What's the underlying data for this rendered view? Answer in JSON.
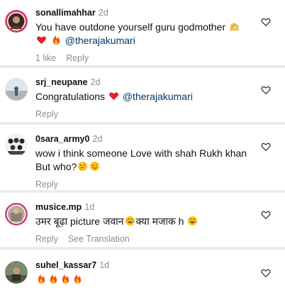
{
  "comments": [
    {
      "username": "sonallimahhar",
      "time": "2d",
      "text_line1": "You have outdone yourself guru godmother",
      "mention": "@therajakumari",
      "emojis": [
        "raising-hands",
        "red-heart",
        "fire"
      ],
      "likes": "1 like",
      "reply": "Reply"
    },
    {
      "username": "srj_neupane",
      "time": "2d",
      "text": "Congratulations",
      "mention": "@therajakumari",
      "emojis": [
        "red-heart"
      ],
      "reply": "Reply"
    },
    {
      "username": "0sara_army0",
      "time": "2d",
      "text_line1": "wow i think someone Love with shah Rukh khan",
      "text_line2": "But who?",
      "emojis": [
        "thinking-face",
        "winking-tongue-face"
      ],
      "reply": "Reply"
    },
    {
      "username": "musice.mp",
      "time": "1d",
      "text_part1": "उमर बूढ़ा picture जवान",
      "text_part2": "क्या मजाक h",
      "emojis": [
        "laughing-tears-face",
        "laughing-tears-face"
      ],
      "reply": "Reply",
      "translation": "See Translation"
    },
    {
      "username": "suhel_kassar7",
      "time": "1d",
      "emojis": [
        "fire",
        "fire",
        "fire",
        "fire"
      ]
    }
  ],
  "colors": {
    "secondary_text": "#8e8e8e",
    "mention": "#00376b",
    "divider": "#ececec"
  }
}
